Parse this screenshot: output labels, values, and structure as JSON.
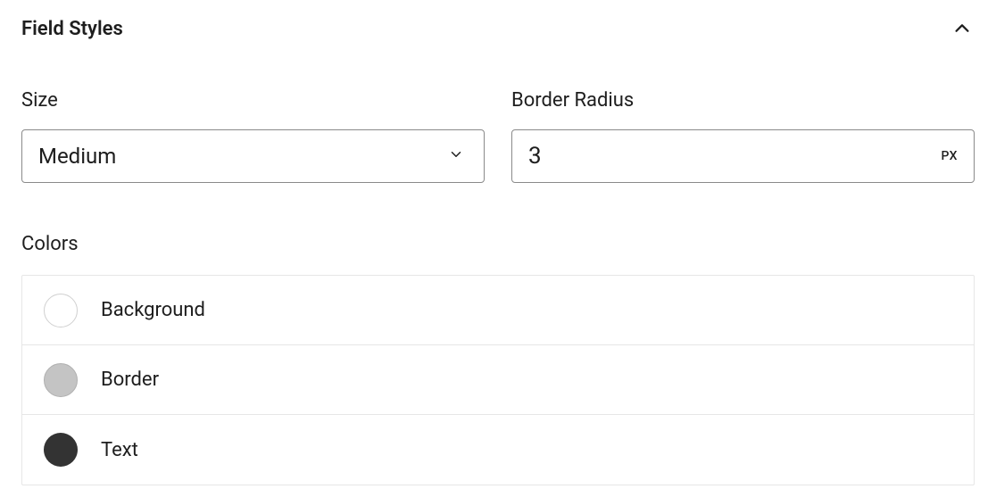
{
  "panel": {
    "title": "Field Styles"
  },
  "size": {
    "label": "Size",
    "value": "Medium"
  },
  "borderRadius": {
    "label": "Border Radius",
    "value": "3",
    "unit": "PX"
  },
  "colors": {
    "label": "Colors",
    "items": [
      {
        "label": "Background",
        "swatch": "#ffffff"
      },
      {
        "label": "Border",
        "swatch": "#c4c4c4"
      },
      {
        "label": "Text",
        "swatch": "#333333"
      }
    ]
  }
}
